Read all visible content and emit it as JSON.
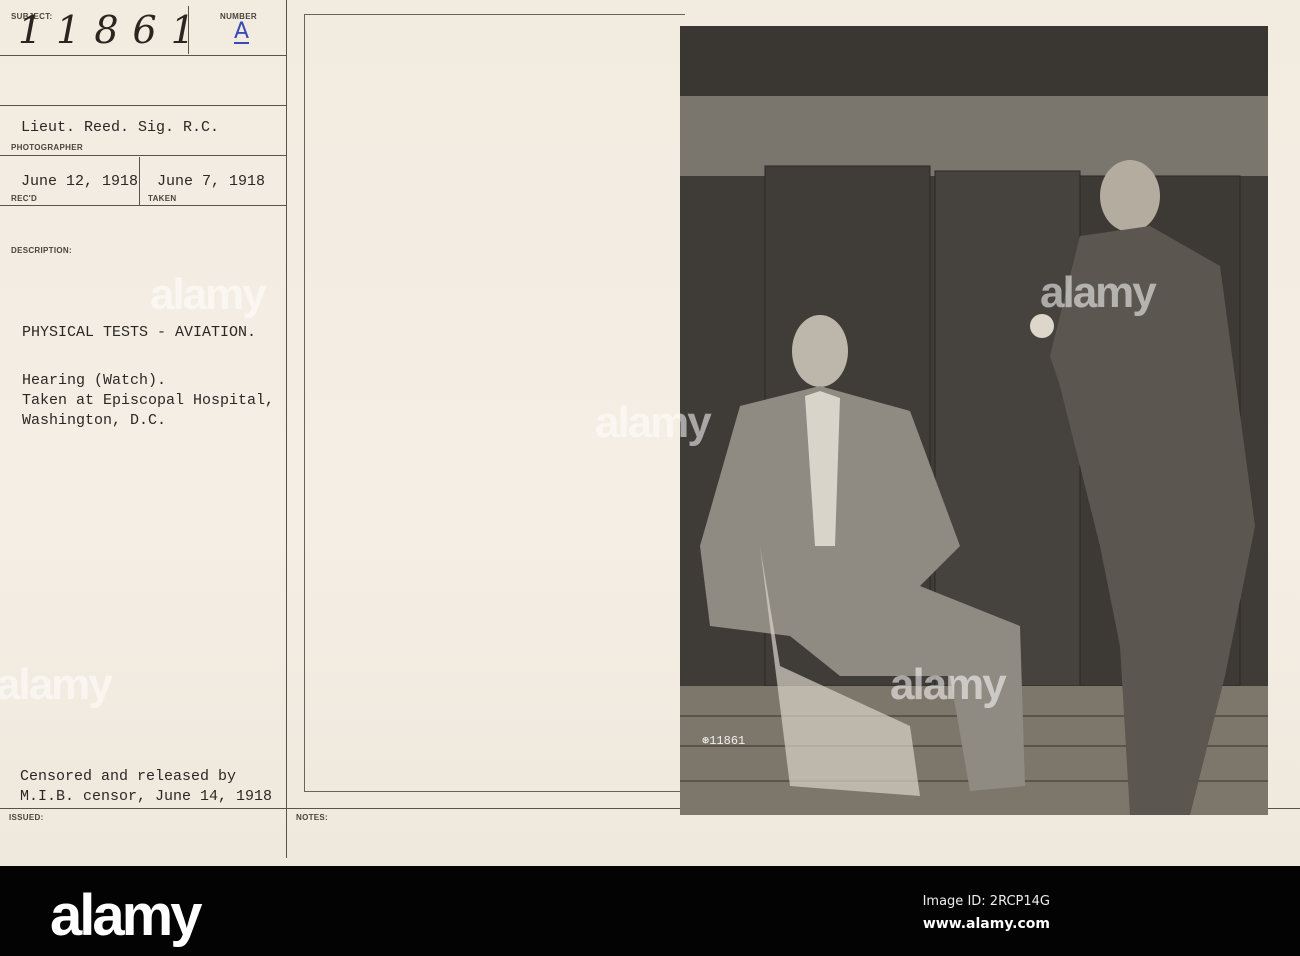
{
  "card": {
    "subject_label": "SUBJECT:",
    "subject_value": "11861",
    "number_label": "NUMBER",
    "number_value": "A",
    "photographer": "Lieut. Reed. Sig. R.C.",
    "photographer_label": "PHOTOGRAPHER",
    "received": "June 12, 1918",
    "received_label": "REC'D",
    "taken": "June 7, 1918",
    "taken_label": "TAKEN",
    "description_label": "DESCRIPTION:",
    "title": "PHYSICAL TESTS - AVIATION.",
    "desc_lines": [
      "Hearing (Watch).",
      "Taken at Episcopal Hospital,",
      "Washington, D.C."
    ],
    "censor_lines": [
      "Censored and released by",
      "M.I.B. censor, June 14, 1918"
    ],
    "issued_label": "ISSUED:",
    "notes_label": "NOTES:",
    "photo_number": "⊛11861"
  },
  "watermark": {
    "text": "alamy"
  },
  "footer": {
    "logo": "alamy",
    "image_id": "Image ID: 2RCP14G",
    "site": "www.alamy.com"
  }
}
